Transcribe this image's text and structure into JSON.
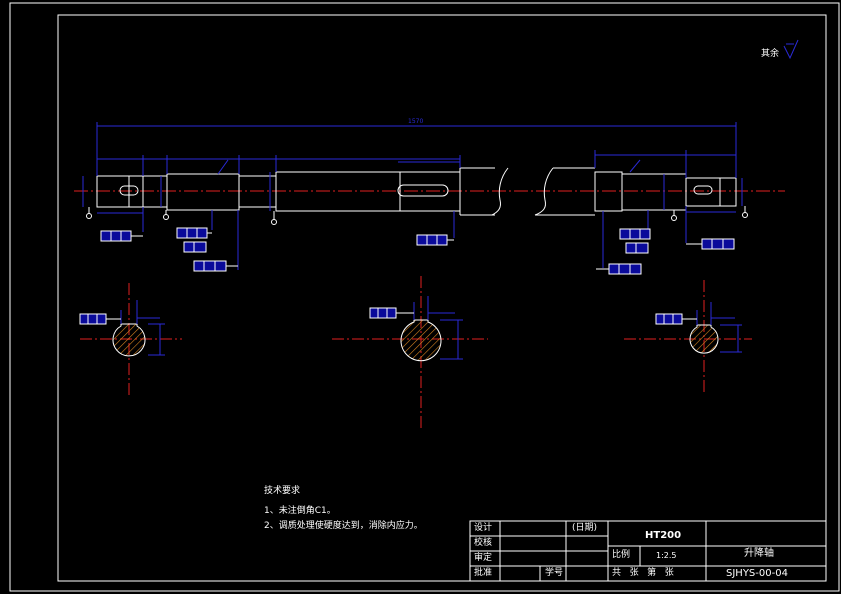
{
  "roughness_note": {
    "label": "其余",
    "symbol": "∇"
  },
  "dimensions": {
    "overall": "1570"
  },
  "tech_requirements": {
    "title": "技术要求",
    "items": [
      "1、未注倒角C1。",
      "2、调质处理使硬度达到，消除内应力。"
    ]
  },
  "title_block": {
    "design": "设计",
    "check": "校核",
    "review": "审定",
    "approve": "批准",
    "date_label": "(日期)",
    "student_no": "学号",
    "material": "HT200",
    "scale_label": "比例",
    "scale_value": "1:2.5",
    "sheets_row": "共   张   第   张",
    "part_name": "升降轴",
    "drawing_no": "SJHYS-00-04"
  },
  "colors": {
    "background": "#000000",
    "outline": "#ffffff",
    "dimension": "#2a2ad8",
    "centerline": "#e02020",
    "hatch": "#d08020",
    "frame_fill": "#0a0a9a"
  }
}
